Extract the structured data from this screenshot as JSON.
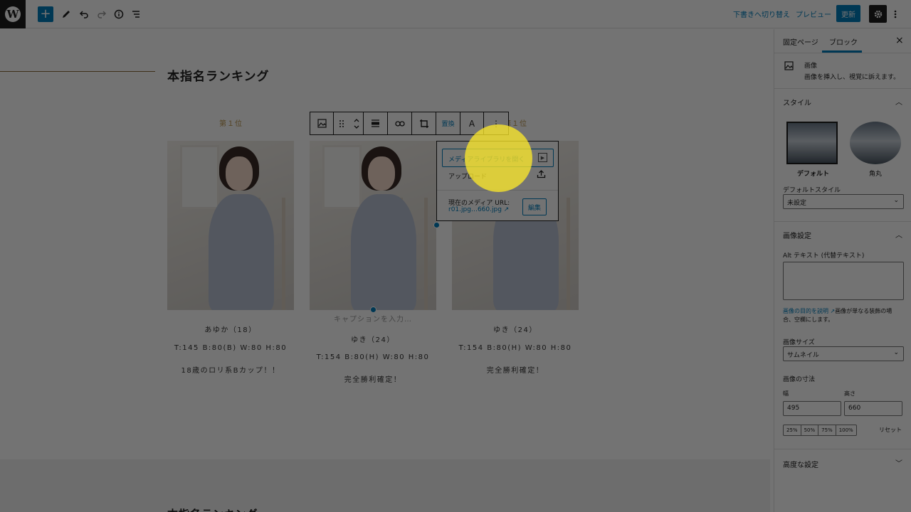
{
  "toolbar": {
    "logo": "W",
    "add": "+",
    "save_draft": "下書きへ切り替え",
    "preview": "プレビュー",
    "update": "更新",
    "icons": [
      "edit-icon",
      "undo-icon",
      "redo-icon",
      "info-icon",
      "list-view-icon",
      "gear-icon",
      "more-icon"
    ]
  },
  "page": {
    "heading": "本指名ランキング",
    "lower_heading": "本指名ランキング"
  },
  "cards": [
    {
      "rank": "第１位",
      "name": "あゆか（18）",
      "stats": "T:145 B:80(B) W:80 H:80",
      "comment": "18歳のロリ系Bカップ！！"
    },
    {
      "rank": "",
      "caption_placeholder": "キャプションを入力…",
      "name": "ゆき（24）",
      "stats": "T:154 B:80(H) W:80 H:80",
      "comment": "完全勝利確定！"
    },
    {
      "rank": "第１位",
      "name": "ゆき（24）",
      "stats": "T:154 B:80(H) W:80 H:80",
      "comment": "完全勝利確定！"
    }
  ],
  "block_toolbar": {
    "replace": "置換",
    "text": "A",
    "more": "⋮"
  },
  "replace_menu": {
    "open_media": "メディアライブラリを開く",
    "upload": "アップロード",
    "current_url_label": "現在のメディア URL:",
    "current_url": "r01.jpg…660.jpg",
    "edit": "編集"
  },
  "sidebar": {
    "tab_page": "固定ページ",
    "tab_block": "ブロック",
    "close": "×",
    "block_name": "画像",
    "block_desc": "画像を挿入し、視覚に訴えます。",
    "style_heading": "スタイル",
    "style_default": "デフォルト",
    "style_rounded": "角丸",
    "default_style_label": "デフォルトスタイル",
    "default_style_value": "未設定",
    "image_settings_heading": "画像設定",
    "alt_label": "Alt テキスト (代替テキスト)",
    "alt_help_link": "画像の目的を説明",
    "alt_help_text1": "画像が単なる装飾の場",
    "alt_help_text2": "合、空欄にします。",
    "size_label": "画像サイズ",
    "size_value": "サムネイル",
    "dimensions_label": "画像の寸法",
    "width_label": "幅",
    "height_label": "高さ",
    "width_value": "495",
    "height_value": "660",
    "percents": [
      "25%",
      "50%",
      "75%",
      "100%"
    ],
    "reset": "リセット",
    "advanced_heading": "高度な設定"
  }
}
